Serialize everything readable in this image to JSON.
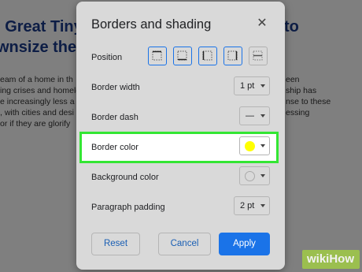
{
  "background_doc": {
    "title_line1": "- Great Tiny",
    "title_line2": "wnsize the D",
    "title_right": "to",
    "body_lines": [
      "eam of a home in th",
      "ing crises and homele",
      "e increasingly less a",
      ", with cities and desi",
      " or if they are glorify"
    ],
    "body_right": [
      "een",
      "ship has",
      "nse to these",
      "essing"
    ]
  },
  "dialog": {
    "title": "Borders and shading",
    "close_icon": "close-icon",
    "rows": {
      "position": {
        "label": "Position"
      },
      "border_width": {
        "label": "Border width",
        "value": "1 pt"
      },
      "border_dash": {
        "label": "Border dash",
        "value": "—"
      },
      "border_color": {
        "label": "Border color",
        "color": "#ffff00"
      },
      "background_color": {
        "label": "Background color",
        "color": "#d9d9d9"
      },
      "paragraph_padding": {
        "label": "Paragraph padding",
        "value": "2 pt"
      }
    },
    "position_buttons": [
      "border-all-icon",
      "border-top-icon",
      "border-left-icon",
      "border-right-icon",
      "border-between-icon"
    ],
    "buttons": {
      "reset": "Reset",
      "cancel": "Cancel",
      "apply": "Apply"
    }
  },
  "colors": {
    "accent": "#1a73e8",
    "highlight": "#33e633",
    "selected_swatch": "#ffff00"
  },
  "watermark": "wikiHow"
}
